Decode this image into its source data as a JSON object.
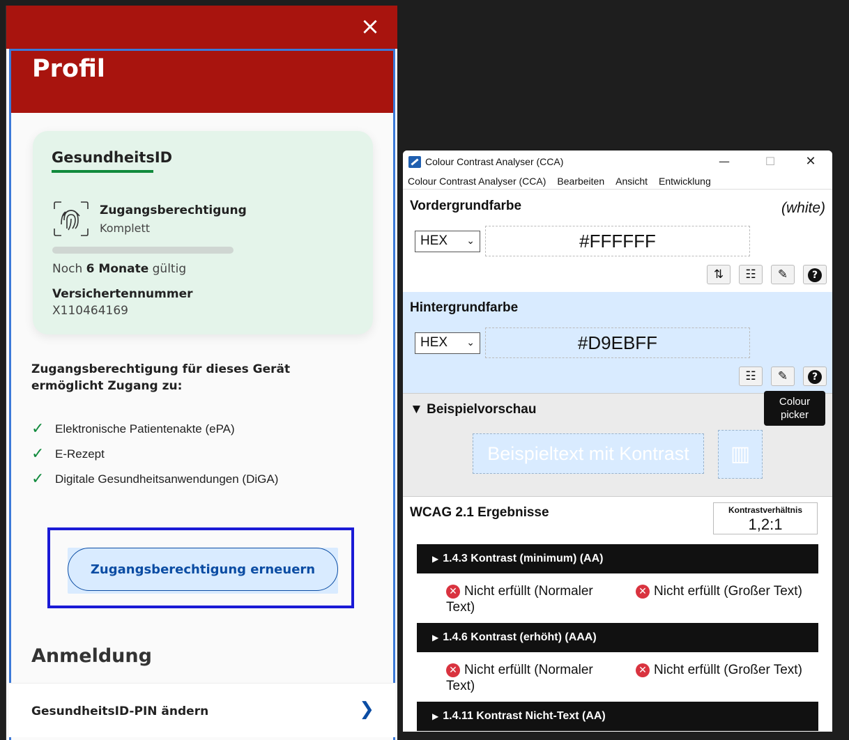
{
  "profile": {
    "title": "Profil",
    "close_icon": "×",
    "card": {
      "title": "GesundheitsID",
      "access_label": "Zugangsberechtigung",
      "access_value": "Komplett",
      "validity_prefix": "Noch ",
      "validity_bold": "6 Monate",
      "validity_suffix": " gültig",
      "insurance_label": "Versichertennummer",
      "insurance_value": "X110464169"
    },
    "access_heading": "Zugangsberechtigung für dieses Gerät ermöglicht Zugang zu:",
    "access_items": [
      "Elektronische Patientenakte (ePA)",
      "E-Rezept",
      "Digitale Gesundheitsanwendungen (DiGA)"
    ],
    "renew_button": "Zugangsberechtigung erneuern",
    "login_heading": "Anmeldung",
    "pin_item": "GesundheitsID-PIN ändern",
    "colors": {
      "brand_red": "#a8140e",
      "accent_green": "#108a3c",
      "link_blue": "#0b4ca3",
      "button_bg": "#d9ebff"
    }
  },
  "cca": {
    "window_title": "Colour Contrast Analyser (CCA)",
    "menu": [
      "Colour Contrast Analyser (CCA)",
      "Bearbeiten",
      "Ansicht",
      "Entwicklung"
    ],
    "foreground": {
      "title": "Vordergrundfarbe",
      "name": "(white)",
      "format": "HEX",
      "value": "#FFFFFF",
      "tools": [
        "swap-icon",
        "sliders-icon",
        "eyedropper-icon",
        "help-icon"
      ]
    },
    "background": {
      "title": "Hintergrundfarbe",
      "format": "HEX",
      "value": "#D9EBFF",
      "tools": [
        "sliders-icon",
        "eyedropper-icon",
        "help-icon"
      ]
    },
    "preview": {
      "title": "Beispielvorschau",
      "sample_text": "Beispieltext mit Kontrast"
    },
    "tooltip": "Colour picker",
    "results": {
      "title": "WCAG 2.1 Ergebnisse",
      "ratio_label": "Kontrastverhältnis",
      "ratio_value": "1,2:1",
      "criteria": [
        {
          "label": "1.4.3 Kontrast (minimum) (AA)",
          "normal": "Nicht erfüllt (Normaler Text)",
          "large": "Nicht erfüllt (Großer Text)"
        },
        {
          "label": "1.4.6 Kontrast (erhöht) (AAA)",
          "normal": "Nicht erfüllt (Normaler Text)",
          "large": "Nicht erfüllt (Großer Text)"
        },
        {
          "label": "1.4.11 Kontrast Nicht-Text (AA)"
        }
      ]
    }
  }
}
